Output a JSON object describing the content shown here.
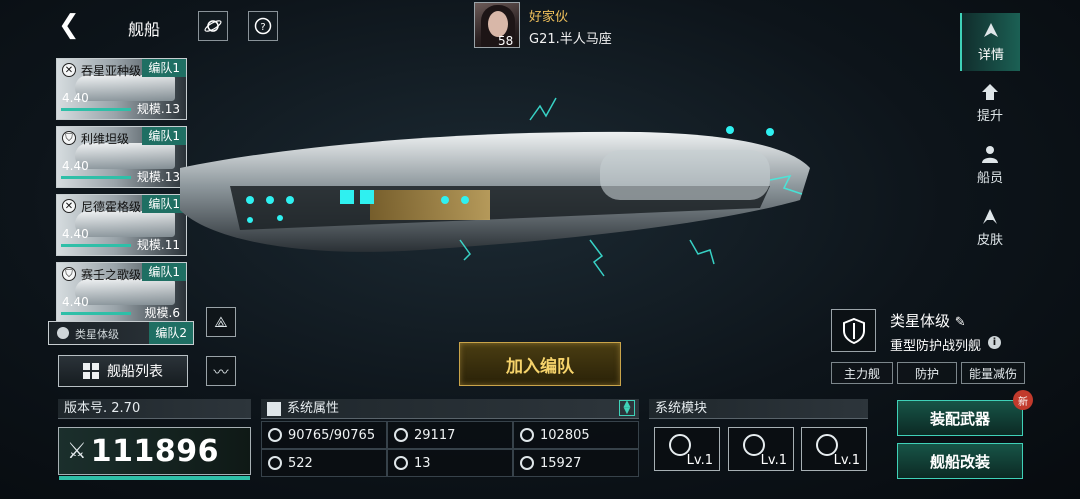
{
  "header": {
    "title": "舰船",
    "back_icon": "back-arrow-icon",
    "planet_icon": "planet-icon",
    "help_icon": "question-icon"
  },
  "player": {
    "name": "好家伙",
    "location": "G21.半人马座",
    "level": "58"
  },
  "fleet_list": [
    {
      "name": "吞星亚种级",
      "team": "编队1",
      "rating": "4.40",
      "scale": "规模.13",
      "class_icon": "x-circle-icon"
    },
    {
      "name": "利维坦级",
      "team": "编队1",
      "rating": "4.40",
      "scale": "规模.13",
      "class_icon": "shield-icon"
    },
    {
      "name": "尼德霍格级",
      "team": "编队1",
      "rating": "4.40",
      "scale": "规模.11",
      "class_icon": "x-circle-icon"
    },
    {
      "name": "赛壬之歌级",
      "team": "编队1",
      "rating": "4.40",
      "scale": "规模.6",
      "class_icon": "shield-icon"
    }
  ],
  "current_ship": {
    "name": "类星体级",
    "team": "编队2"
  },
  "ship_list_button": "舰船列表",
  "right_tabs": [
    {
      "label": "详情",
      "icon": "details-icon",
      "active": true
    },
    {
      "label": "提升",
      "icon": "upgrade-icon",
      "active": false
    },
    {
      "label": "船员",
      "icon": "crew-icon",
      "active": false
    },
    {
      "label": "皮肤",
      "icon": "skin-icon",
      "active": false
    }
  ],
  "class_info": {
    "name": "类星体级",
    "type": "重型防护战列舰",
    "tags": [
      "主力舰",
      "防护",
      "能量减伤"
    ]
  },
  "join_button": "加入编队",
  "version": "版本号. 2.70",
  "power": "111896",
  "attributes": {
    "title": "系统属性",
    "items": [
      {
        "value": "90765/90765",
        "icon": "hull-icon"
      },
      {
        "value": "29117",
        "icon": "armor-icon"
      },
      {
        "value": "102805",
        "icon": "attack-icon"
      },
      {
        "value": "522",
        "icon": "speed-icon"
      },
      {
        "value": "13",
        "icon": "grid-icon"
      },
      {
        "value": "15927",
        "icon": "shield-energy-icon"
      }
    ]
  },
  "modules": {
    "title": "系统模块",
    "slots": [
      {
        "level": "Lv.1",
        "icon": "cannon-module-icon"
      },
      {
        "level": "Lv.1",
        "icon": "rocket-module-icon"
      },
      {
        "level": "Lv.1",
        "icon": "radar-module-icon"
      }
    ]
  },
  "actions": {
    "equip": "装配武器",
    "modify": "舰船改装",
    "new_badge": "新"
  },
  "colors": {
    "accent": "#3fd1b8",
    "team_badge": "#1f6f63",
    "gold": "#f6d36b",
    "player_name": "#f0c15b"
  }
}
